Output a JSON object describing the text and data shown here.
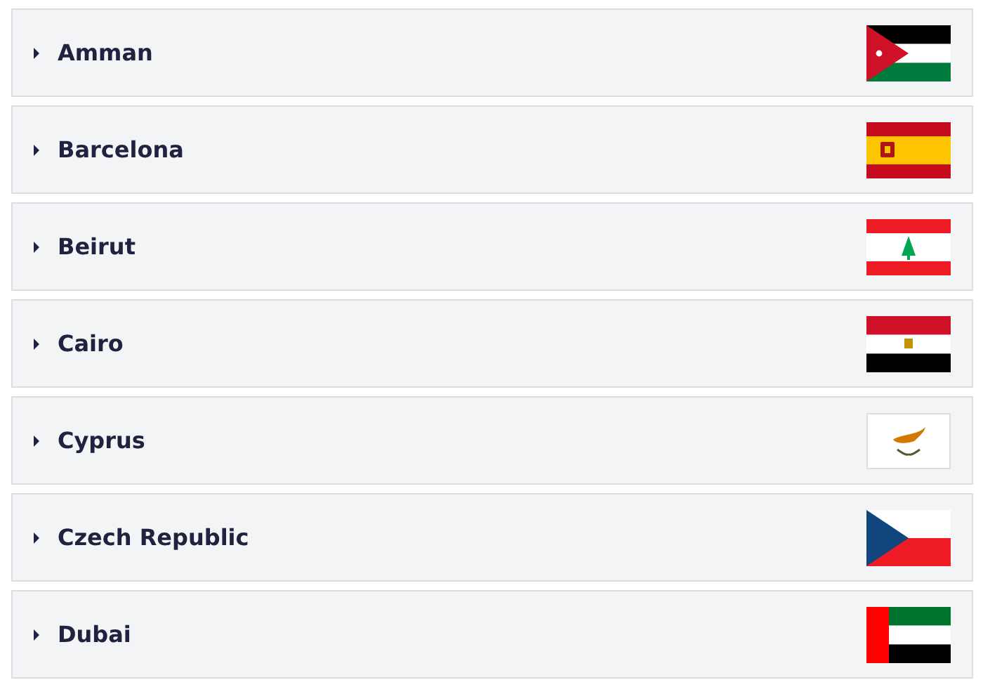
{
  "destinations": [
    {
      "name": "Amman",
      "expanded": false,
      "kind": "jordan"
    },
    {
      "name": "Barcelona",
      "expanded": false,
      "kind": "spain"
    },
    {
      "name": "Beirut",
      "expanded": false,
      "kind": "lebanon"
    },
    {
      "name": "Cairo",
      "expanded": false,
      "kind": "egypt"
    },
    {
      "name": "Cyprus",
      "expanded": false,
      "kind": "cyprus"
    },
    {
      "name": "Czech Republic",
      "expanded": false,
      "kind": "czech"
    },
    {
      "name": "Dubai",
      "expanded": false,
      "kind": "uae"
    }
  ]
}
